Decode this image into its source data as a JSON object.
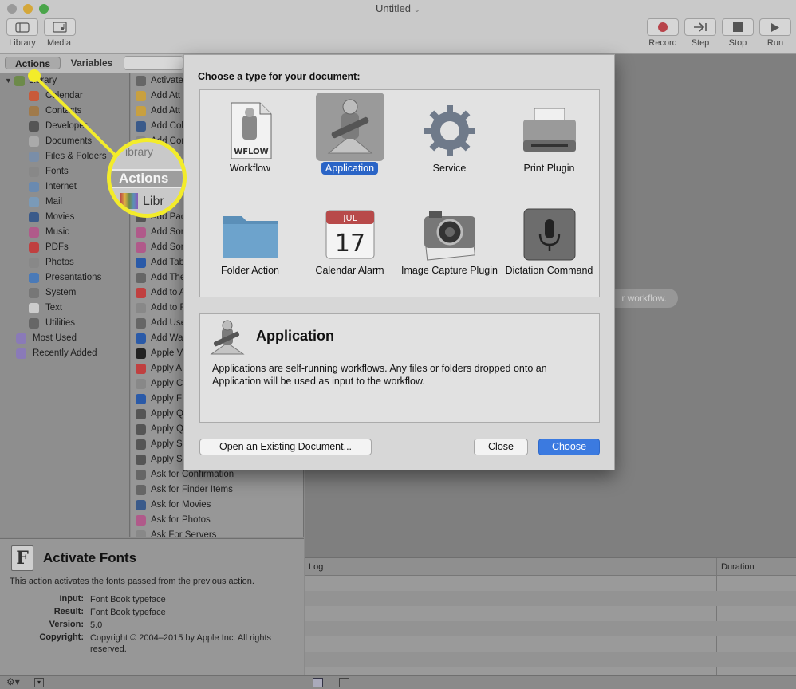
{
  "window": {
    "title": "Untitled",
    "title_chevron": "⌄",
    "toolbar_left": [
      {
        "label": "Library",
        "icon": "library-icon"
      },
      {
        "label": "Media",
        "icon": "media-icon"
      }
    ],
    "toolbar_right": [
      {
        "label": "Record",
        "icon": "record-icon"
      },
      {
        "label": "Step",
        "icon": "step-icon"
      },
      {
        "label": "Stop",
        "icon": "stop-icon"
      },
      {
        "label": "Run",
        "icon": "run-icon"
      }
    ]
  },
  "library_tabs": {
    "actions": "Actions",
    "variables": "Variables"
  },
  "library": {
    "root": "Library",
    "items": [
      "Calendar",
      "Contacts",
      "Developer",
      "Documents",
      "Files & Folders",
      "Fonts",
      "Internet",
      "Mail",
      "Movies",
      "Music",
      "PDFs",
      "Photos",
      "Presentations",
      "System",
      "Text",
      "Utilities"
    ],
    "extras": [
      "Most Used",
      "Recently Added"
    ]
  },
  "actions_list": [
    "Activate",
    "Add Att",
    "Add Att",
    "Add Col",
    "Add Cor",
    "",
    "",
    "",
    "",
    "Add Pac",
    "Add Sor",
    "Add Sor",
    "Add Tab",
    "Add The",
    "Add to A",
    "Add to F",
    "Add Use",
    "Add Wa",
    "Apple V",
    "Apply A",
    "Apply C",
    "Apply F",
    "Apply Q",
    "Apply Q",
    "Apply S",
    "Apply S",
    "Ask for Confirmation",
    "Ask for Finder Items",
    "Ask for Movies",
    "Ask for Photos",
    "Ask For Servers"
  ],
  "description": {
    "title": "Activate Fonts",
    "summary": "This action activates the fonts passed from the previous action.",
    "input_label": "Input:",
    "input": "Font Book typeface",
    "result_label": "Result:",
    "result": "Font Book typeface",
    "version_label": "Version:",
    "version": "5.0",
    "copyright_label": "Copyright:",
    "copyright": "Copyright © 2004–2015 by Apple Inc. All rights reserved."
  },
  "workflow_hint": "r workflow.",
  "log": {
    "log_header": "Log",
    "duration_header": "Duration"
  },
  "dialog": {
    "heading": "Choose a type for your document:",
    "types": [
      {
        "label": "Workflow",
        "icon": "workflow-icon",
        "icon_text": "WFLOW",
        "selected": false
      },
      {
        "label": "Application",
        "icon": "application-icon",
        "selected": true
      },
      {
        "label": "Service",
        "icon": "service-gear-icon",
        "selected": false
      },
      {
        "label": "Print Plugin",
        "icon": "printer-icon",
        "selected": false
      },
      {
        "label": "Folder Action",
        "icon": "folder-icon",
        "selected": false
      },
      {
        "label": "Calendar Alarm",
        "icon": "calendar-icon",
        "month": "JUL",
        "day": "17",
        "selected": false
      },
      {
        "label": "Image Capture Plugin",
        "icon": "camera-icon",
        "selected": false
      },
      {
        "label": "Dictation Command",
        "icon": "microphone-icon",
        "selected": false
      }
    ],
    "detail_title": "Application",
    "detail_text": "Applications are self-running workflows. Any files or folders dropped onto an Application will be used as input to the workflow.",
    "open_existing": "Open an Existing Document...",
    "close": "Close",
    "choose": "Choose"
  },
  "callout": {
    "label": "Actions",
    "above": "ibrary",
    "below": "Libr",
    "color": "#f3ec2a"
  }
}
